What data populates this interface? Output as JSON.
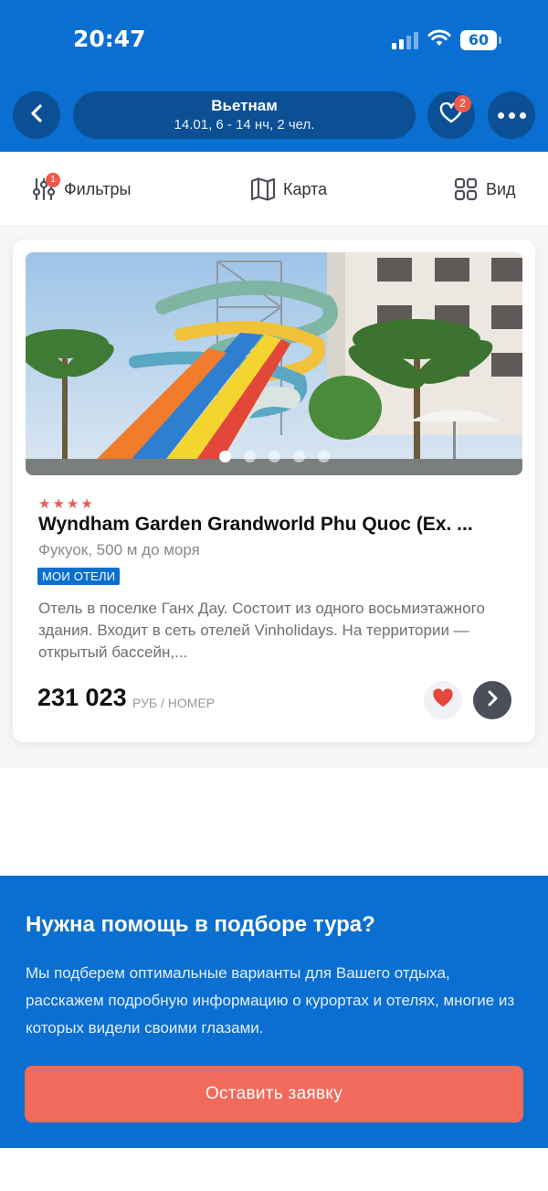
{
  "status_bar": {
    "time": "20:47",
    "battery": "60"
  },
  "header": {
    "title": "Вьетнам",
    "subtitle": "14.01, 6 - 14 нч, 2 чел.",
    "favorites_count": "2"
  },
  "toolbar": {
    "filters_label": "Фильтры",
    "filters_count": "1",
    "map_label": "Карта",
    "view_label": "Вид"
  },
  "hotel": {
    "stars": "★★★★",
    "name": "Wyndham Garden Grandworld Phu Quoc (Ex. ...",
    "location": "Фукуок, 500 м до моря",
    "tag": "МОИ ОТЕЛИ",
    "description": "Отель в поселке Ганх Дау. Состоит из одного восьмиэтажного здания. Входит в сеть отелей Vinholidays. На территории — открытый бассейн,...",
    "price": "231 023",
    "price_unit": "РУБ / НОМЕР",
    "photo_count": 5,
    "photo_active_index": 0
  },
  "help": {
    "title": "Нужна помощь в подборе тура?",
    "text": "Мы подберем оптимальные варианты для Вашего отдыха, расскажем подробную информацию о курортах и отелях, многие из которых видели своими глазами.",
    "button_label": "Оставить заявку"
  },
  "colors": {
    "brand_blue": "#0a6fd1",
    "dark_blue": "#0b4f94",
    "accent_red": "#f0584a",
    "cta": "#f26a5b"
  },
  "icons": [
    "back-arrow-icon",
    "heart-icon",
    "more-dots-icon",
    "sliders-icon",
    "map-icon",
    "grid-icon",
    "chevron-right-icon",
    "wifi-icon",
    "signal-icon",
    "battery-icon"
  ]
}
